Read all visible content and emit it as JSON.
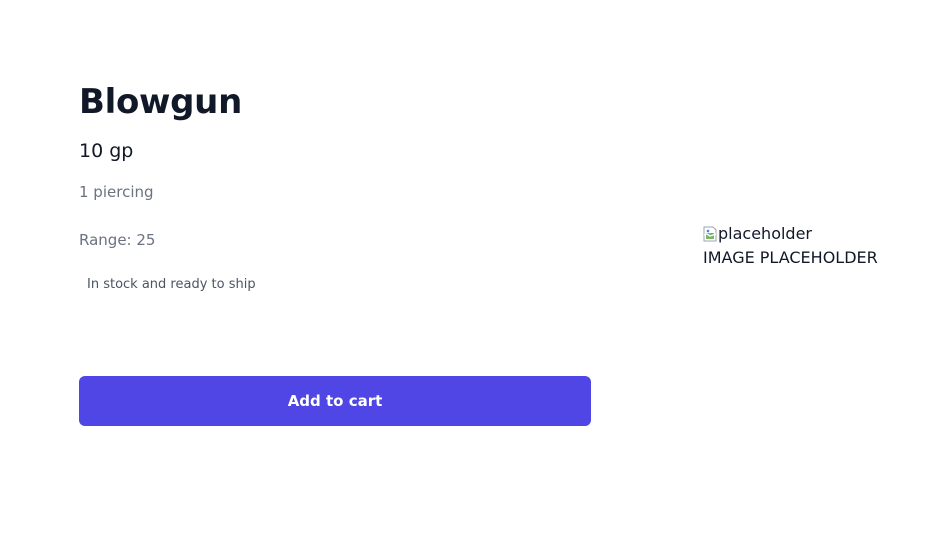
{
  "product": {
    "title": "Blowgun",
    "price": "10 gp",
    "damage": "1 piercing",
    "range": "Range: 25",
    "stock_status": "In stock and ready to ship"
  },
  "actions": {
    "add_to_cart_label": "Add to cart"
  },
  "image": {
    "alt_text": "placeholder",
    "caption": "IMAGE PLACEHOLDER",
    "icon": "broken-image-icon"
  },
  "colors": {
    "accent": "#4f46e5",
    "heading": "#111827",
    "muted": "#6b7280"
  }
}
